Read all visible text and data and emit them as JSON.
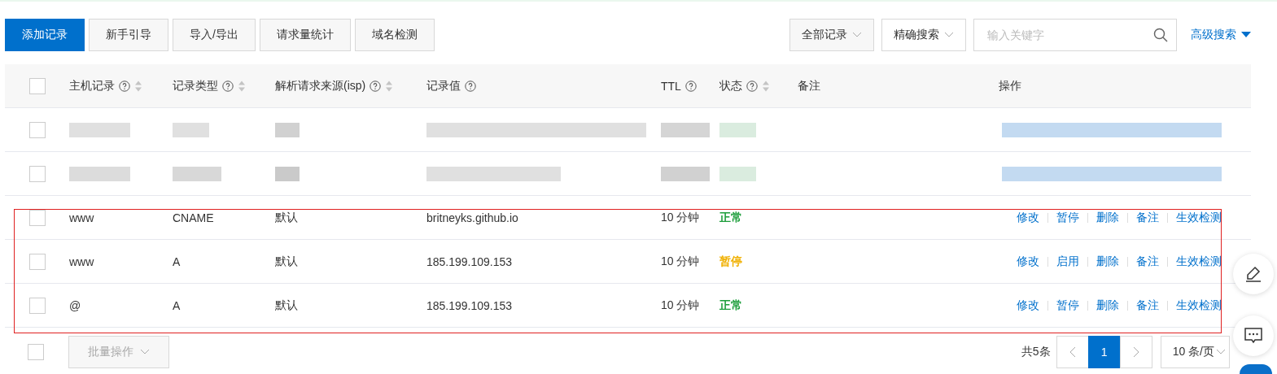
{
  "toolbar": {
    "buttons": [
      {
        "label": "添加记录",
        "primary": true
      },
      {
        "label": "新手引导",
        "primary": false
      },
      {
        "label": "导入/导出",
        "primary": false
      },
      {
        "label": "请求量统计",
        "primary": false
      },
      {
        "label": "域名检测",
        "primary": false
      }
    ],
    "filter": {
      "value": "全部记录"
    },
    "mode": {
      "value": "精确搜索"
    },
    "search": {
      "placeholder": "输入关键字"
    },
    "advanced": "高级搜索"
  },
  "table": {
    "select_all": {
      "checked": false
    },
    "columns": [
      {
        "label": "主机记录",
        "kind": "sortable"
      },
      {
        "label": "记录类型",
        "kind": "sortable"
      },
      {
        "label": "解析请求来源(isp)",
        "kind": "sortable"
      },
      {
        "label": "记录值",
        "kind": "help"
      },
      {
        "label": "TTL",
        "kind": "help"
      },
      {
        "label": "状态",
        "kind": "sortable"
      },
      {
        "label": "备注",
        "kind": "plain"
      },
      {
        "label": "操作",
        "kind": "plain"
      }
    ],
    "rows": [
      {
        "kind": "blurred",
        "checked": false
      },
      {
        "kind": "blurred",
        "checked": false
      },
      {
        "kind": "record",
        "checked": false,
        "host": "www",
        "type": "CNAME",
        "isp": "默认",
        "value": "britneyks.github.io",
        "ttl": "10 分钟",
        "status": {
          "text": "正常",
          "color": "#1e9e3c"
        },
        "actions": [
          "修改",
          "暂停",
          "删除",
          "备注",
          "生效检测"
        ]
      },
      {
        "kind": "record",
        "checked": false,
        "host": "www",
        "type": "A",
        "isp": "默认",
        "value": "185.199.109.153",
        "ttl": "10 分钟",
        "status": {
          "text": "暂停",
          "color": "#f0b000"
        },
        "actions": [
          "修改",
          "启用",
          "删除",
          "备注",
          "生效检测"
        ]
      },
      {
        "kind": "record",
        "checked": false,
        "host": "@",
        "type": "A",
        "isp": "默认",
        "value": "185.199.109.153",
        "ttl": "10 分钟",
        "status": {
          "text": "正常",
          "color": "#1e9e3c"
        },
        "actions": [
          "修改",
          "暂停",
          "删除",
          "备注",
          "生效检测"
        ]
      }
    ]
  },
  "footer": {
    "checked": false,
    "batch": {
      "label": "批量操作",
      "disabled": true
    },
    "total": "共5条",
    "pages": [
      {
        "label": "1",
        "selected": true
      }
    ],
    "page_size": "10 条/页"
  }
}
